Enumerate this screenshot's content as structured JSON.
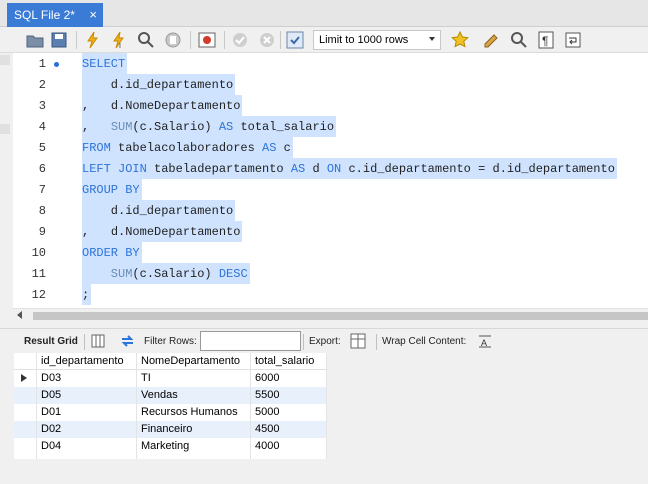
{
  "tab": {
    "title": "SQL File 2*",
    "close": "×"
  },
  "toolbar": {
    "limit_select": "Limit to 1000 rows",
    "icons": [
      "open-file-icon",
      "save-icon",
      "execute-icon",
      "execute-current-icon",
      "explain-icon",
      "stop-icon",
      "toggle-error-icon",
      "commit-icon",
      "rollback-icon",
      "autocommit-icon",
      "favorite-snippet-icon",
      "beautify-icon",
      "find-icon",
      "invisible-chars-icon",
      "wrap-icon"
    ]
  },
  "editor": {
    "lines": [
      {
        "num": "1",
        "tokens": [
          [
            "kw",
            "SELECT"
          ]
        ]
      },
      {
        "num": "2",
        "tokens": [
          [
            "id",
            "    d.id_departamento"
          ]
        ]
      },
      {
        "num": "3",
        "tokens": [
          [
            "op",
            ",   "
          ],
          [
            "id",
            "d.NomeDepartamento"
          ]
        ]
      },
      {
        "num": "4",
        "tokens": [
          [
            "op",
            ",   "
          ],
          [
            "fn",
            "SUM"
          ],
          [
            "id",
            "(c.Salario) "
          ],
          [
            "kw",
            "AS"
          ],
          [
            "id",
            " total_salario"
          ]
        ]
      },
      {
        "num": "5",
        "tokens": [
          [
            "kw",
            "FROM"
          ],
          [
            "id",
            " tabelacolaboradores "
          ],
          [
            "kw",
            "AS"
          ],
          [
            "id",
            " c"
          ]
        ]
      },
      {
        "num": "6",
        "tokens": [
          [
            "kw",
            "LEFT JOIN"
          ],
          [
            "id",
            " tabeladepartamento "
          ],
          [
            "kw",
            "AS"
          ],
          [
            "id",
            " d "
          ],
          [
            "kw",
            "ON"
          ],
          [
            "id",
            " c.id_departamento = d.id_departamento"
          ]
        ]
      },
      {
        "num": "7",
        "tokens": [
          [
            "kw",
            "GROUP BY"
          ]
        ]
      },
      {
        "num": "8",
        "tokens": [
          [
            "id",
            "    d.id_departamento"
          ]
        ]
      },
      {
        "num": "9",
        "tokens": [
          [
            "op",
            ",   "
          ],
          [
            "id",
            "d.NomeDepartamento"
          ]
        ]
      },
      {
        "num": "10",
        "tokens": [
          [
            "kw",
            "ORDER BY"
          ]
        ]
      },
      {
        "num": "11",
        "tokens": [
          [
            "fn",
            "    SUM"
          ],
          [
            "id",
            "(c.Salario) "
          ],
          [
            "kw",
            "DESC"
          ]
        ]
      },
      {
        "num": "12",
        "tokens": [
          [
            "op",
            ";"
          ]
        ]
      }
    ]
  },
  "results_toolbar": {
    "result_grid": "Result Grid",
    "filter_rows": "Filter Rows:",
    "filter_value": "",
    "export": "Export:",
    "wrap_cell": "Wrap Cell Content:"
  },
  "grid": {
    "columns": [
      "id_departamento",
      "NomeDepartamento",
      "total_salario"
    ],
    "rows": [
      [
        "D03",
        "TI",
        "6000"
      ],
      [
        "D05",
        "Vendas",
        "5500"
      ],
      [
        "D01",
        "Recursos Humanos",
        "5000"
      ],
      [
        "D02",
        "Financeiro",
        "4500"
      ],
      [
        "D04",
        "Marketing",
        "4000"
      ]
    ]
  },
  "colors": {
    "tab": "#3a7bd5",
    "selection": "#cfe3ff",
    "keyword": "#2d74d8",
    "alt_row": "#e8f0fc"
  }
}
